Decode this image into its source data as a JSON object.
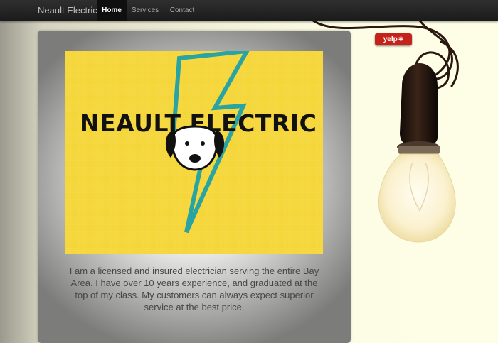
{
  "navbar": {
    "brand": "Neault Electric",
    "items": [
      {
        "label": "Home",
        "active": true
      },
      {
        "label": "Services",
        "active": false
      },
      {
        "label": "Contact",
        "active": false
      }
    ]
  },
  "logo": {
    "text": "NEAULT ELECTRIC"
  },
  "intro": "I am a licensed and insured electrician serving the entire Bay Area. I have over 10 years experience, and graduated at the top of my class. My customers can always expect superior service at the best price.",
  "yelp": {
    "label": "yelp",
    "icon": "yelp-burst-icon"
  },
  "colors": {
    "navbar": "#1f1f1f",
    "logo_background": "#f5d63a",
    "bolt_outline": "#2aa3a3",
    "yelp_red": "#c4221a"
  }
}
